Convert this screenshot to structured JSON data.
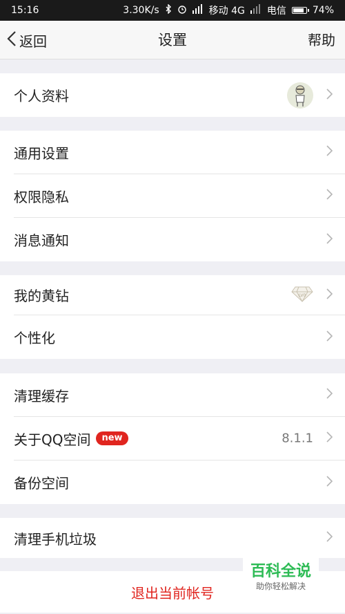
{
  "status_bar": {
    "time": "15:16",
    "speed": "3.30K/s",
    "carrier1": "移动 4G",
    "carrier2": "电信",
    "battery": "74%",
    "battery_level": 0.74
  },
  "nav": {
    "back_label": "返回",
    "title": "设置",
    "help_label": "帮助"
  },
  "groups": [
    {
      "items": [
        {
          "label": "个人资料",
          "right": "avatar"
        }
      ]
    },
    {
      "items": [
        {
          "label": "通用设置"
        },
        {
          "label": "权限隐私"
        },
        {
          "label": "消息通知"
        }
      ]
    },
    {
      "items": [
        {
          "label": "我的黄钻",
          "right": "diamond-icon"
        },
        {
          "label": "个性化"
        }
      ]
    },
    {
      "items": [
        {
          "label": "清理缓存"
        },
        {
          "label": "关于QQ空间",
          "badge": "new",
          "value": "8.1.1"
        },
        {
          "label": "备份空间"
        }
      ]
    },
    {
      "items": [
        {
          "label": "清理手机垃圾"
        }
      ]
    }
  ],
  "logout_label": "退出当前帐号",
  "watermark": {
    "title": "百科全说",
    "subtitle": "助你轻松解决"
  },
  "colors": {
    "accent_red": "#e0251f",
    "watermark_green": "#2dbb55"
  }
}
